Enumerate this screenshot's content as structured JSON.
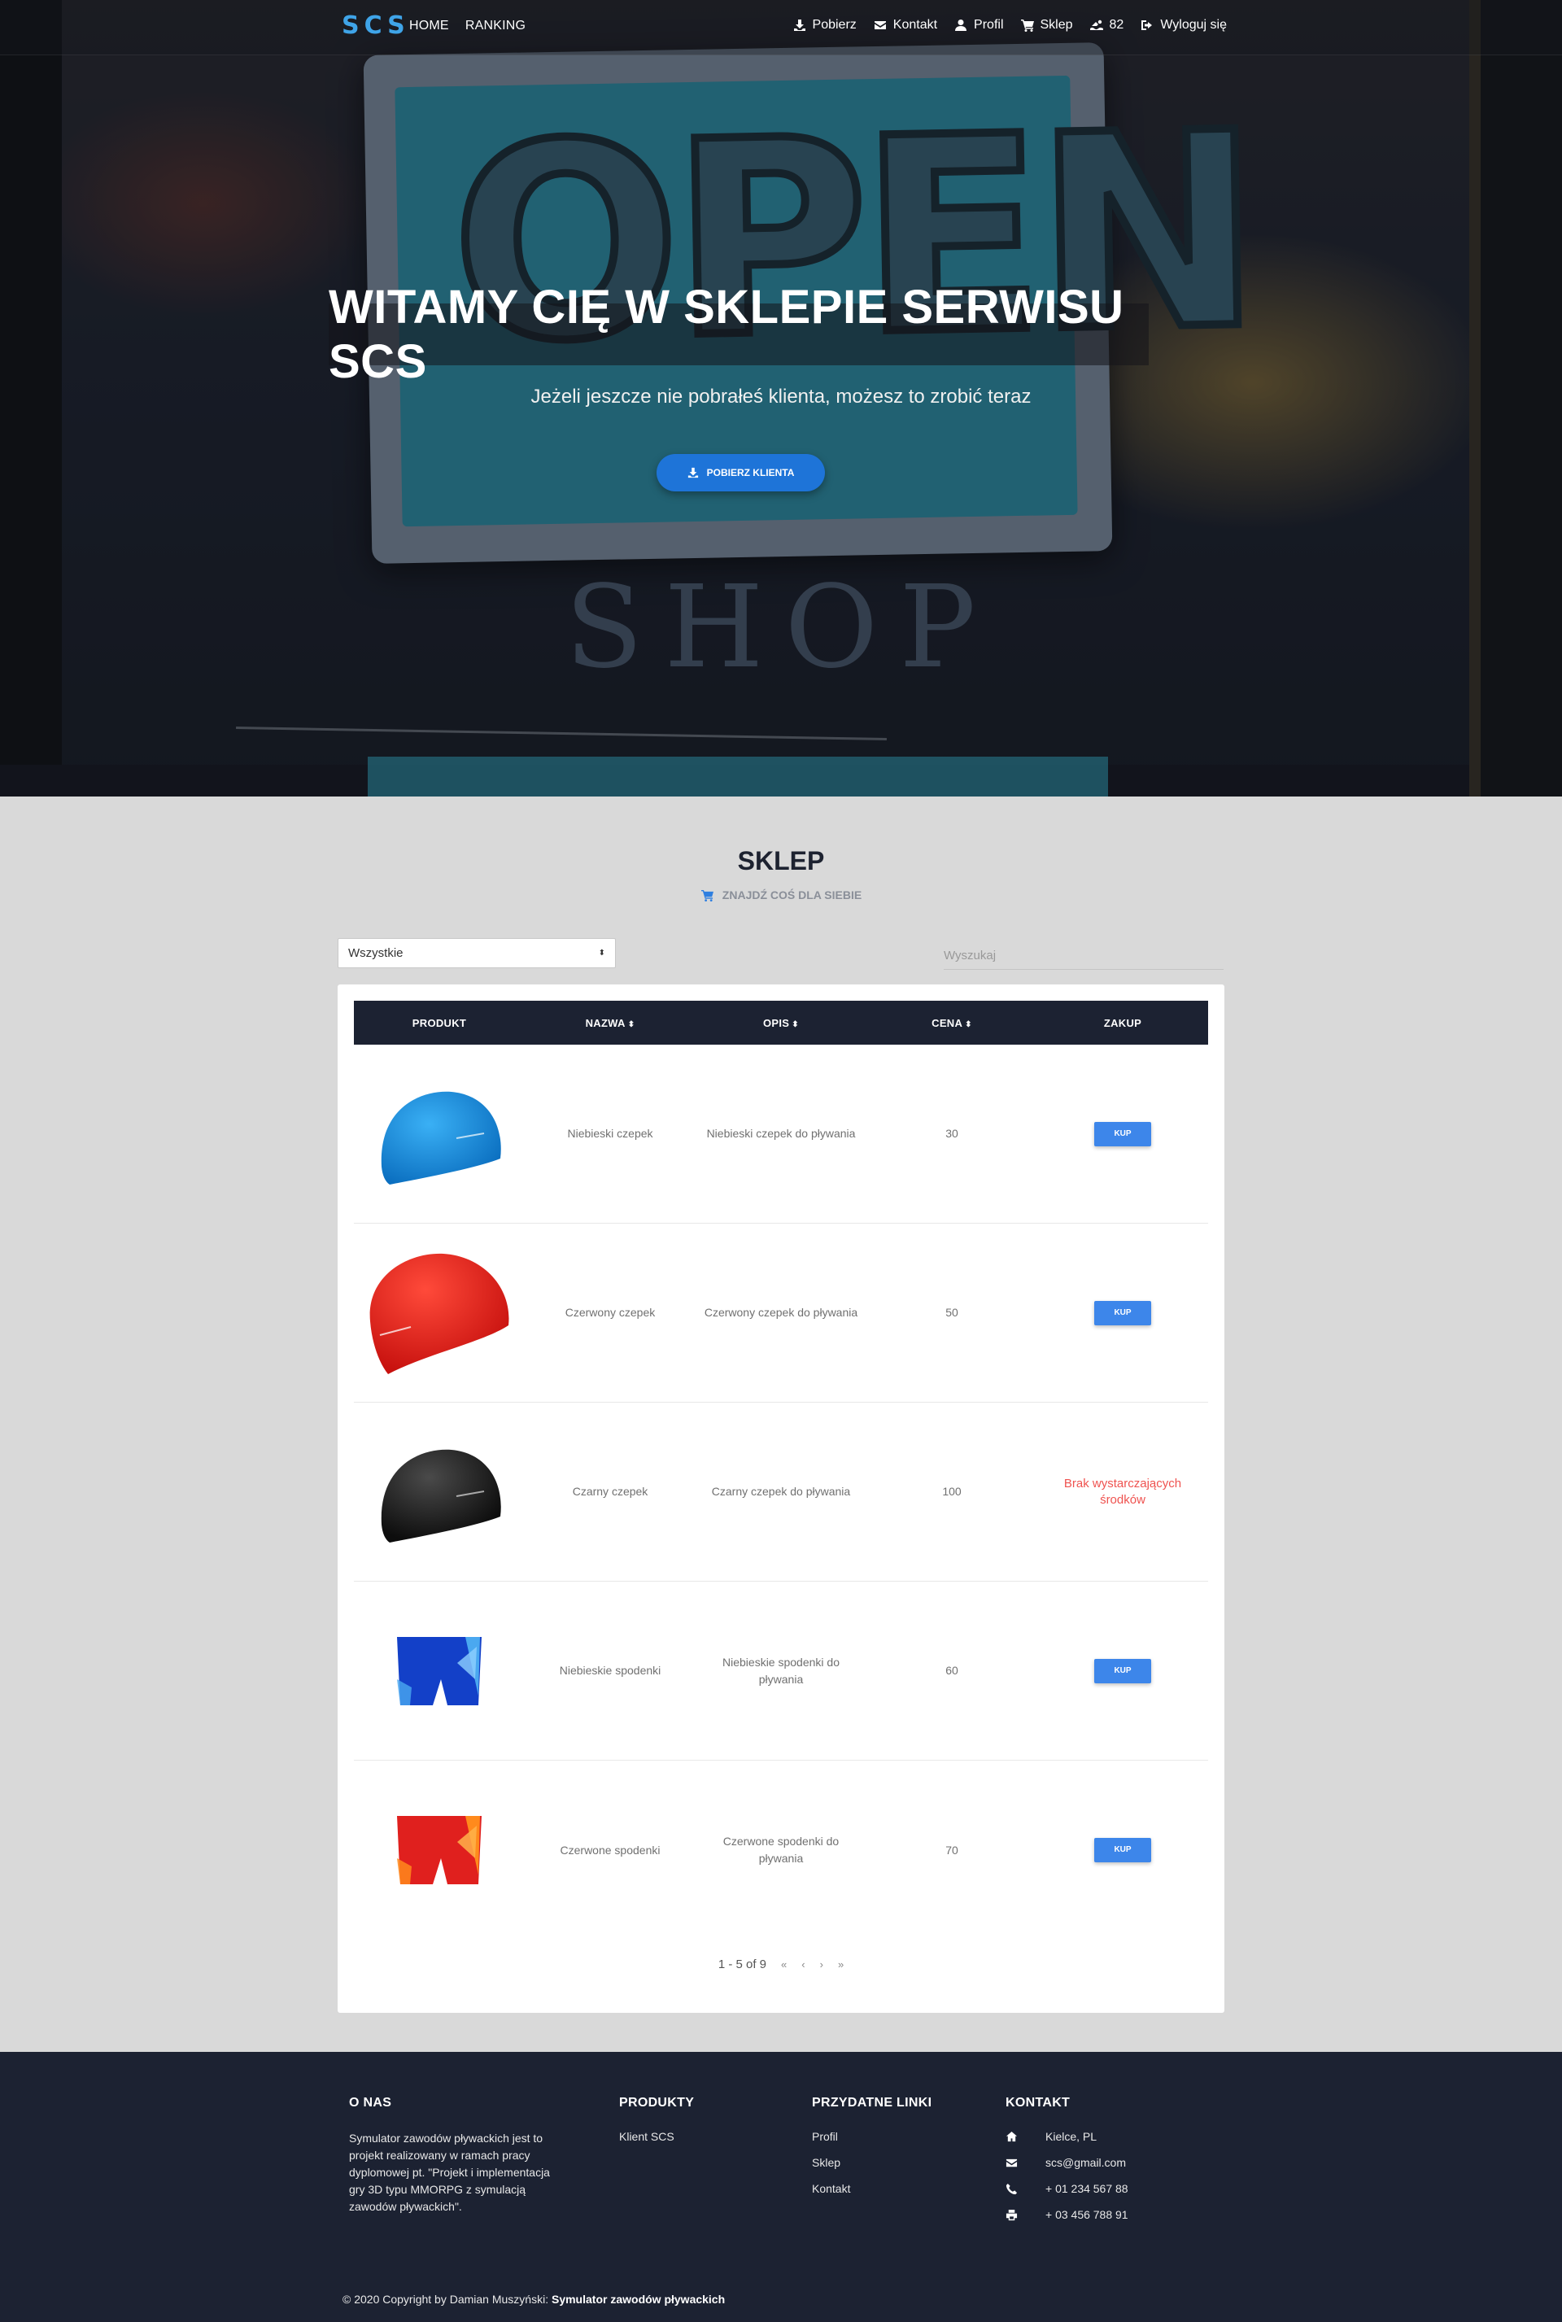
{
  "nav": {
    "logo": "SCS",
    "left_links": [
      "HOME",
      "RANKING"
    ],
    "right": {
      "download": "Pobierz",
      "contact": "Kontakt",
      "profile": "Profil",
      "shop": "Sklep",
      "points": "82",
      "logout": "Wyloguj się"
    }
  },
  "hero": {
    "title": "WITAMY CIĘ W SKLEPIE SERWISU SCS",
    "subtitle": "Jeżeli jeszcze nie pobrałeś klienta, możesz to zrobić teraz",
    "button": "POBIERZ KLIENTA",
    "photo_sign_text": "OPEN",
    "photo_shop_text": "SHOP"
  },
  "shop": {
    "title": "SKLEP",
    "subtitle": "ZNAJDŹ COŚ DLA SIEBIE",
    "filter_value": "Wszystkie",
    "search_placeholder": "Wyszukaj",
    "columns": [
      "PRODUKT",
      "NAZWA",
      "OPIS",
      "CENA",
      "ZAKUP"
    ],
    "buy_label": "KUP",
    "rows": [
      {
        "name": "Niebieski czepek",
        "desc": "Niebieski czepek do pływania",
        "price": "30",
        "action": "buy",
        "image": "blue-cap",
        "color": "#1e8fe0"
      },
      {
        "name": "Czerwony czepek",
        "desc": "Czerwony czepek do pływania",
        "price": "50",
        "action": "buy",
        "image": "red-cap",
        "color": "#e5261f"
      },
      {
        "name": "Czarny czepek",
        "desc": "Czarny czepek do pływania",
        "price": "100",
        "action": "insufficient",
        "action_text": "Brak wystarczających środków",
        "image": "black-cap",
        "color": "#1a1a1a"
      },
      {
        "name": "Niebieskie spodenki",
        "desc": "Niebieskie spodenki do pływania",
        "price": "60",
        "action": "buy",
        "image": "blue-trunks",
        "color": "#1340c8"
      },
      {
        "name": "Czerwone spodenki",
        "desc": "Czerwone spodenki do pływania",
        "price": "70",
        "action": "buy",
        "image": "red-trunks",
        "color": "#e0201e"
      }
    ],
    "pagination": {
      "range": "1 - 5 of 9",
      "first": "«",
      "prev": "‹",
      "next": "›",
      "last": "»"
    }
  },
  "footer": {
    "about": {
      "title": "O NAS",
      "text": "Symulator zawodów pływackich jest to projekt realizowany w ramach pracy dyplomowej pt. \"Projekt i implementacja gry 3D typu MMORPG z symulacją zawodów pływackich\"."
    },
    "products": {
      "title": "PRODUKTY",
      "items": [
        "Klient SCS"
      ]
    },
    "links": {
      "title": "PRZYDATNE LINKI",
      "items": [
        "Profil",
        "Sklep",
        "Kontakt"
      ]
    },
    "contact": {
      "title": "KONTAKT",
      "address": "Kielce, PL",
      "email": "scs@gmail.com",
      "phone": "+ 01 234 567 88",
      "fax": "+ 03 456 788 91"
    },
    "copyright_prefix": "© 2020 Copyright by Damian Muszyński:",
    "copyright_link": "Symulator zawodów pływackich"
  },
  "colors": {
    "accent": "#1e74d8",
    "dark": "#1c2232",
    "error": "#ef5350",
    "logo": "#3fa4e8"
  }
}
